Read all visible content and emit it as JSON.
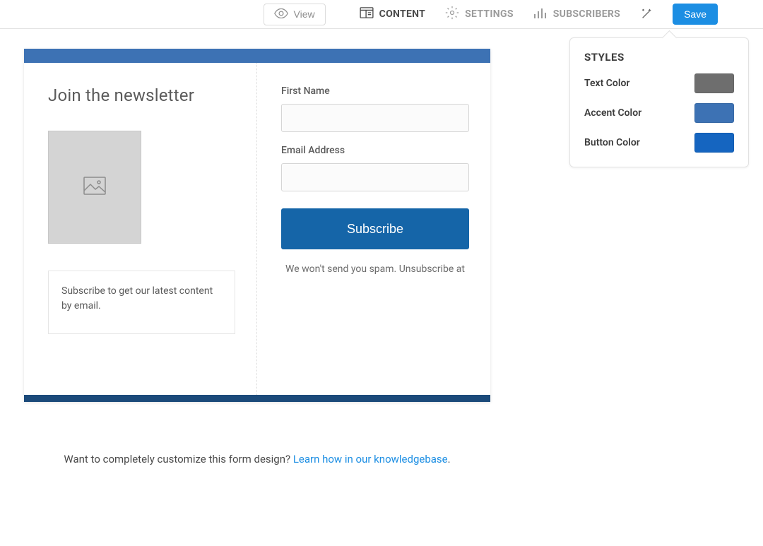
{
  "topbar": {
    "view_label": "View",
    "tabs": {
      "content": "CONTENT",
      "settings": "SETTINGS",
      "subscribers": "SUBSCRIBERS"
    },
    "save_label": "Save"
  },
  "form": {
    "title": "Join the newsletter",
    "description": "Subscribe to get our latest content by email.",
    "first_name_label": "First Name",
    "email_label": "Email Address",
    "subscribe_label": "Subscribe",
    "nospam_text": "We won't send you spam. Unsubscribe at"
  },
  "styles_panel": {
    "heading": "STYLES",
    "rows": {
      "text_color": {
        "label": "Text Color",
        "value": "#6e6e6e"
      },
      "accent_color": {
        "label": "Accent Color",
        "value": "#3d72b4"
      },
      "button_color": {
        "label": "Button Color",
        "value": "#1565c0"
      }
    }
  },
  "help": {
    "prefix": "Want to completely customize this form design? ",
    "link_text": "Learn how in our knowledgebase",
    "suffix": "."
  }
}
